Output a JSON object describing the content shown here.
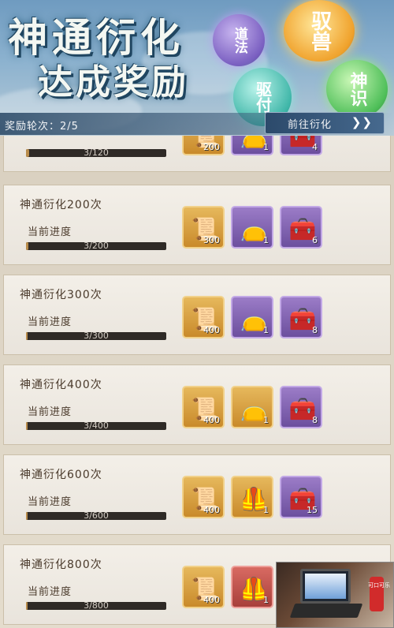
{
  "header": {
    "title_line1": "神通衍化",
    "title_line2": "达成奖励",
    "orbs": [
      {
        "text": "道法",
        "color": "#7a5fc1"
      },
      {
        "text": "驭兽",
        "color": "#f0a22c"
      },
      {
        "text": "驱付",
        "color": "#3fb6a8"
      },
      {
        "text": "神识",
        "color": "#4fbf59"
      }
    ],
    "round_label": "奖励轮次：2/5",
    "goto_label": "前往衍化",
    "goto_icon": "chevron-right-icon"
  },
  "tasks": [
    {
      "title": "",
      "progress_label": "",
      "progress_text": "3/120",
      "progress_ratio": 0.025,
      "rewards": [
        {
          "icon": "scroll-icon",
          "qty": "200",
          "color": "gold"
        },
        {
          "icon": "pouch-icon",
          "qty": "1",
          "color": "purple"
        },
        {
          "icon": "chest-icon",
          "qty": "4",
          "color": "purple"
        }
      ]
    },
    {
      "title": "神通衍化200次",
      "progress_label": "当前进度",
      "progress_text": "3/200",
      "progress_ratio": 0.015,
      "rewards": [
        {
          "icon": "scroll-icon",
          "qty": "300",
          "color": "gold"
        },
        {
          "icon": "pouch-icon",
          "qty": "1",
          "color": "purple"
        },
        {
          "icon": "chest-icon",
          "qty": "6",
          "color": "purple"
        }
      ]
    },
    {
      "title": "神通衍化300次",
      "progress_label": "当前进度",
      "progress_text": "3/300",
      "progress_ratio": 0.01,
      "rewards": [
        {
          "icon": "scroll-icon",
          "qty": "400",
          "color": "gold"
        },
        {
          "icon": "pouch-icon",
          "qty": "1",
          "color": "purple"
        },
        {
          "icon": "chest-icon",
          "qty": "8",
          "color": "purple"
        }
      ]
    },
    {
      "title": "神通衍化400次",
      "progress_label": "当前进度",
      "progress_text": "3/400",
      "progress_ratio": 0.0075,
      "rewards": [
        {
          "icon": "scroll-icon",
          "qty": "400",
          "color": "gold"
        },
        {
          "icon": "pouch-icon",
          "qty": "1",
          "color": "gold"
        },
        {
          "icon": "chest-icon",
          "qty": "8",
          "color": "purple"
        }
      ]
    },
    {
      "title": "神通衍化600次",
      "progress_label": "当前进度",
      "progress_text": "3/600",
      "progress_ratio": 0.005,
      "rewards": [
        {
          "icon": "scroll-icon",
          "qty": "400",
          "color": "gold"
        },
        {
          "icon": "vest-icon",
          "qty": "1",
          "color": "gold"
        },
        {
          "icon": "chest-icon",
          "qty": "15",
          "color": "purple"
        }
      ]
    },
    {
      "title": "神通衍化800次",
      "progress_label": "当前进度",
      "progress_text": "3/800",
      "progress_ratio": 0.004,
      "rewards": [
        {
          "icon": "scroll-icon",
          "qty": "400",
          "color": "gold"
        },
        {
          "icon": "vest-icon",
          "qty": "1",
          "color": "red"
        }
      ]
    }
  ],
  "ad": {
    "can_text": "可口可乐"
  }
}
